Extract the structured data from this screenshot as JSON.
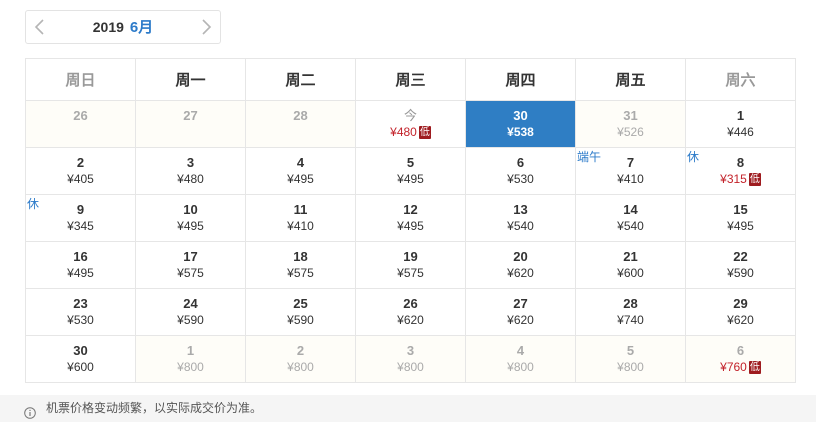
{
  "nav": {
    "year": "2019",
    "month": "6月"
  },
  "weekdays": [
    {
      "label": "周日",
      "weekend": true
    },
    {
      "label": "周一",
      "weekend": false
    },
    {
      "label": "周二",
      "weekend": false
    },
    {
      "label": "周三",
      "weekend": false
    },
    {
      "label": "周四",
      "weekend": false
    },
    {
      "label": "周五",
      "weekend": false
    },
    {
      "label": "周六",
      "weekend": true
    }
  ],
  "weeks": [
    [
      {
        "day": "26",
        "price": "",
        "out": true
      },
      {
        "day": "27",
        "price": "",
        "out": true
      },
      {
        "day": "28",
        "price": "",
        "out": true
      },
      {
        "day": "今",
        "price": "¥480",
        "low": true,
        "today": true
      },
      {
        "day": "30",
        "price": "¥538",
        "selected": true
      },
      {
        "day": "31",
        "price": "¥526",
        "out": true
      },
      {
        "day": "1",
        "price": "¥446"
      }
    ],
    [
      {
        "day": "2",
        "price": "¥405"
      },
      {
        "day": "3",
        "price": "¥480"
      },
      {
        "day": "4",
        "price": "¥495"
      },
      {
        "day": "5",
        "price": "¥495"
      },
      {
        "day": "6",
        "price": "¥530"
      },
      {
        "day": "7",
        "price": "¥410",
        "tag": "端午"
      },
      {
        "day": "8",
        "price": "¥315",
        "low": true,
        "tag": "休"
      }
    ],
    [
      {
        "day": "9",
        "price": "¥345",
        "tag": "休"
      },
      {
        "day": "10",
        "price": "¥495"
      },
      {
        "day": "11",
        "price": "¥410"
      },
      {
        "day": "12",
        "price": "¥495"
      },
      {
        "day": "13",
        "price": "¥540"
      },
      {
        "day": "14",
        "price": "¥540"
      },
      {
        "day": "15",
        "price": "¥495"
      }
    ],
    [
      {
        "day": "16",
        "price": "¥495"
      },
      {
        "day": "17",
        "price": "¥575"
      },
      {
        "day": "18",
        "price": "¥575"
      },
      {
        "day": "19",
        "price": "¥575"
      },
      {
        "day": "20",
        "price": "¥620"
      },
      {
        "day": "21",
        "price": "¥600"
      },
      {
        "day": "22",
        "price": "¥590"
      }
    ],
    [
      {
        "day": "23",
        "price": "¥530"
      },
      {
        "day": "24",
        "price": "¥590"
      },
      {
        "day": "25",
        "price": "¥590"
      },
      {
        "day": "26",
        "price": "¥620"
      },
      {
        "day": "27",
        "price": "¥620"
      },
      {
        "day": "28",
        "price": "¥740"
      },
      {
        "day": "29",
        "price": "¥620"
      }
    ],
    [
      {
        "day": "30",
        "price": "¥600"
      },
      {
        "day": "1",
        "price": "¥800",
        "out": true
      },
      {
        "day": "2",
        "price": "¥800",
        "out": true
      },
      {
        "day": "3",
        "price": "¥800",
        "out": true
      },
      {
        "day": "4",
        "price": "¥800",
        "out": true
      },
      {
        "day": "5",
        "price": "¥800",
        "out": true
      },
      {
        "day": "6",
        "price": "¥760",
        "out": true,
        "low": true
      }
    ]
  ],
  "low_badge_label": "低",
  "notice": {
    "text": "机票价格变动频繁，以实际成交价为准。"
  },
  "colors": {
    "accent": "#2f7ec4",
    "low_price": "#c3222a",
    "low_badge": "#9e1b1f"
  }
}
